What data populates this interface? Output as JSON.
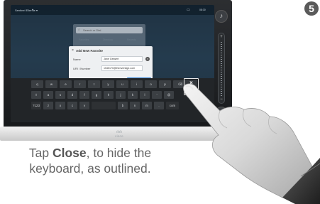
{
  "step": {
    "number": "5"
  },
  "device": {
    "status": {
      "left": "Sentinel Ellernie ▾",
      "right": "08:30"
    },
    "search_panel": {
      "placeholder": "Search or Dial",
      "tabs": [
        "Favorites",
        "Directory",
        "Recents"
      ]
    },
    "dialog": {
      "title": "Add New Favorite",
      "name_label": "Name",
      "name_value": "Jane Gessert",
      "uri_label": "URI / Number",
      "uri_value": "1545170@theriveridge.com",
      "save_label": "Save"
    },
    "keyboard": {
      "row1": [
        "q",
        "w",
        "e",
        "r",
        "t",
        "y",
        "u",
        "i",
        "o",
        "p",
        "⌫"
      ],
      "row2": [
        "⇧",
        "a",
        "s",
        "d",
        "f",
        "g",
        "h",
        "j",
        "k",
        "l",
        "'",
        "@"
      ],
      "row3": [
        "?123",
        "z",
        "x",
        "c",
        "v",
        "",
        "b",
        "n",
        "m",
        ".",
        "com"
      ],
      "close_label": "Close",
      "close_icon": "close-icon"
    },
    "logo": "cisco"
  },
  "caption": {
    "pre": "Tap ",
    "bold": "Close",
    "post_line1": ", to hide the",
    "line2": "keyboard, as outlined."
  },
  "colors": {
    "accent": "#2f7fd6",
    "caption_text": "#666666",
    "step_badge": "#5a5a5a"
  }
}
